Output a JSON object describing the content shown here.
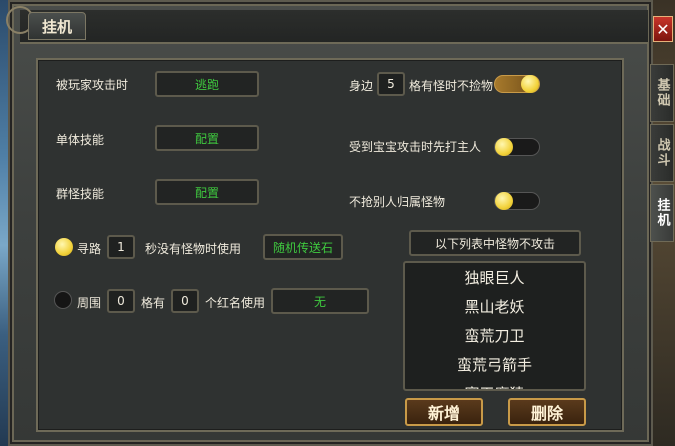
{
  "window": {
    "title": "挂机",
    "close_label": "✕"
  },
  "side_tabs": [
    {
      "label": "基础",
      "active": false
    },
    {
      "label": "战斗",
      "active": false
    },
    {
      "label": "挂机",
      "active": true
    }
  ],
  "left": {
    "attacked_by_player": {
      "label": "被玩家攻击时",
      "action": "逃跑"
    },
    "single_skill": {
      "label": "单体技能",
      "action": "配置"
    },
    "group_skill": {
      "label": "群怪技能",
      "action": "配置"
    },
    "pathfind": {
      "enabled": true,
      "label": "寻路",
      "seconds": "1",
      "suffix": "秒没有怪物时使用",
      "item": "随机传送石"
    },
    "surround": {
      "enabled": false,
      "label": "周围",
      "count1": "0",
      "mid": "格有",
      "count2": "0",
      "suffix": "个红名使用",
      "item": "无"
    }
  },
  "right": {
    "no_loot": {
      "prefix": "身边",
      "value": "5",
      "suffix": "格有怪时不捡物",
      "on": true
    },
    "attack_master": {
      "label": "受到宝宝攻击时先打主人",
      "on": false
    },
    "no_steal": {
      "label": "不抢别人归属怪物",
      "on": false
    },
    "list_header": "以下列表中怪物不攻击",
    "monsters": [
      "独眼巨人",
      "黑山老妖",
      "蛮荒刀卫",
      "蛮荒弓箭手",
      "寒天魔猿"
    ],
    "add_button": "新增",
    "delete_button": "删除"
  },
  "colors": {
    "accent_green": "#3fc93f",
    "knob_yellow": "#f2d23a",
    "border_gold": "#c89a48"
  }
}
